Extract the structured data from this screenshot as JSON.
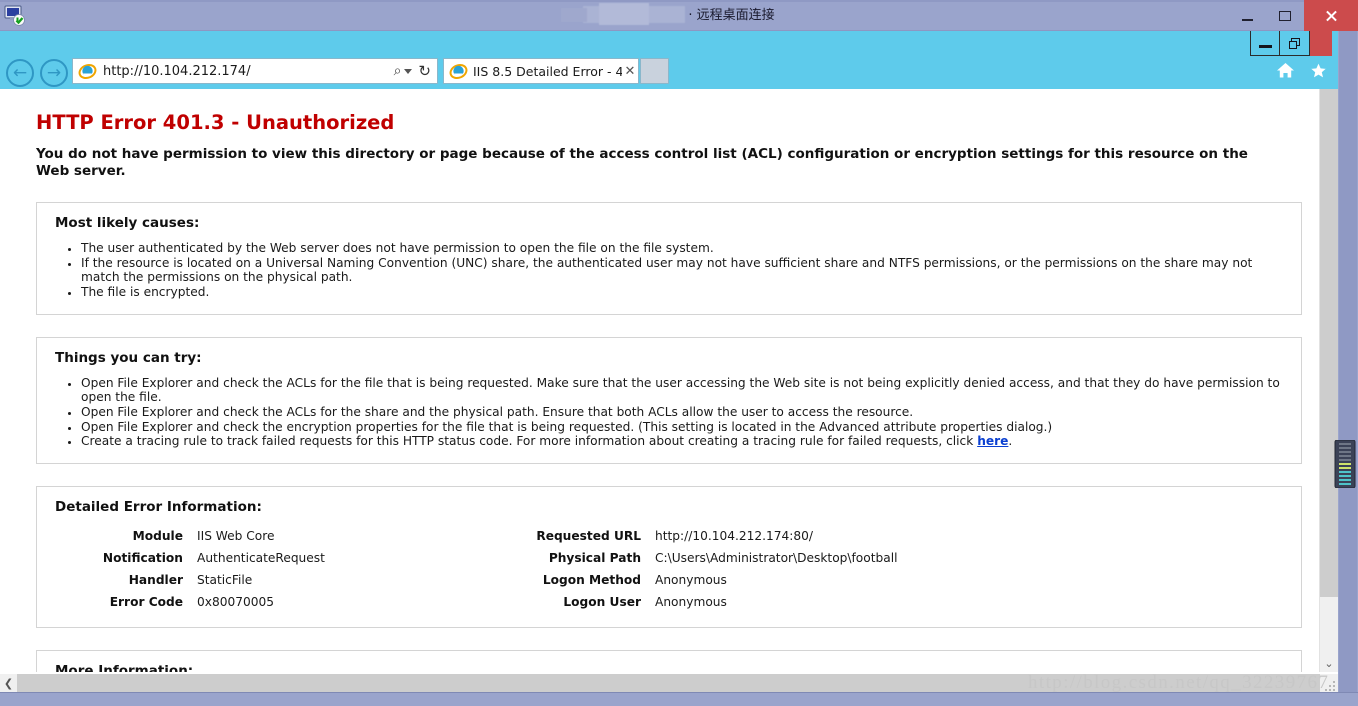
{
  "rdp": {
    "title_suffix": "· 远程桌面连接",
    "app_icon": "remote-desktop-icon",
    "minimize_label": "–",
    "restore_label": "❐",
    "close_label": "✕"
  },
  "browser": {
    "back_glyph": "←",
    "forward_glyph": "→",
    "url": "http://10.104.212.174/",
    "search_glyph": "⌕",
    "refresh_glyph": "↻",
    "tab_title": "IIS 8.5 Detailed Error - 4...",
    "tab_close_glyph": "✕",
    "home_icon": "home-icon",
    "favorites_icon": "star-icon",
    "window_minimize": "–",
    "window_restore": "❐"
  },
  "error": {
    "heading": "HTTP Error 401.3 - Unauthorized",
    "lede": "You do not have permission to view this directory or page because of the access control list (ACL) configuration or encryption settings for this resource on the Web server.",
    "causes": {
      "heading": "Most likely causes:",
      "items": [
        "The user authenticated by the Web server does not have permission to open the file on the file system.",
        "If the resource is located on a Universal Naming Convention (UNC) share, the authenticated user may not have sufficient share and NTFS permissions, or the permissions on the share may not match the permissions on the physical path.",
        "The file is encrypted."
      ]
    },
    "things": {
      "heading": "Things you can try:",
      "items": [
        "Open File Explorer and check the ACLs for the file that is being requested. Make sure that the user accessing the Web site is not being explicitly denied access, and that they do have permission to open the file.",
        "Open File Explorer and check the ACLs for the share and the physical path. Ensure that both ACLs allow the user to access the resource.",
        "Open File Explorer and check the encryption properties for the file that is being requested. (This setting is located in the Advanced attribute properties dialog.)"
      ],
      "tracing_prefix": "Create a tracing rule to track failed requests for this HTTP status code. For more information about creating a tracing rule for failed requests, click ",
      "tracing_link": "here",
      "tracing_suffix": "."
    },
    "details": {
      "heading": "Detailed Error Information:",
      "left": [
        {
          "key": "Module",
          "value": "IIS Web Core"
        },
        {
          "key": "Notification",
          "value": "AuthenticateRequest"
        },
        {
          "key": "Handler",
          "value": "StaticFile"
        },
        {
          "key": "Error Code",
          "value": "0x80070005"
        }
      ],
      "right": [
        {
          "key": "Requested URL",
          "value": "http://10.104.212.174:80/"
        },
        {
          "key": "Physical Path",
          "value": "C:\\Users\\Administrator\\Desktop\\football"
        },
        {
          "key": "Logon Method",
          "value": "Anonymous"
        },
        {
          "key": "Logon User",
          "value": "Anonymous"
        }
      ]
    },
    "more_info": {
      "heading": "More Information:"
    }
  },
  "scroll": {
    "down_glyph": "⌄",
    "left_glyph": "❮"
  },
  "watermark": "http://blog.csdn.net/qq_32239767",
  "colors": {
    "error_red": "#c00000",
    "ie_blue": "#5ecbeb",
    "rdp_bar": "#9aa4cc",
    "close_red": "#cc4b4c",
    "link_blue": "#0a3fd1"
  }
}
